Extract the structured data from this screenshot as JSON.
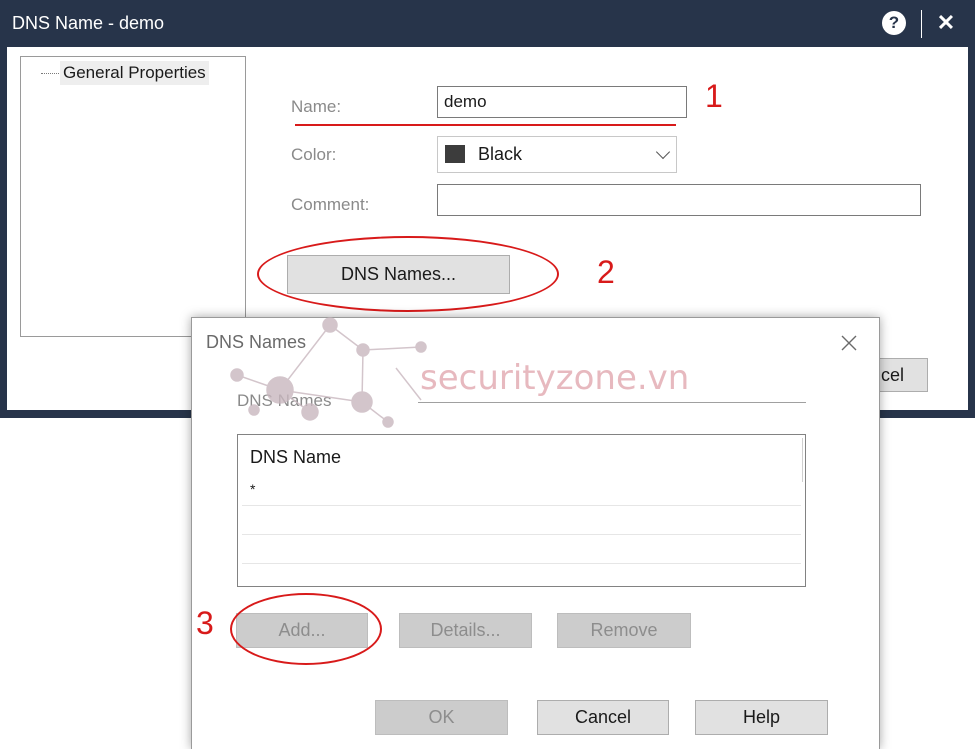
{
  "main_dialog": {
    "title": "DNS Name - demo",
    "help_icon_glyph": "?",
    "close_icon_glyph": "✕",
    "tree_item": "General Properties",
    "name_label": "Name:",
    "name_value": "demo",
    "color_label": "Color:",
    "color_value": "Black",
    "color_swatch": "#3c3c3c",
    "comment_label": "Comment:",
    "comment_value": "",
    "dns_names_button": "DNS Names...",
    "cancel_button_visible": "cel"
  },
  "sub_dialog": {
    "title": "DNS Names",
    "close_icon_glyph": "✕",
    "group_label": "DNS Names",
    "table_header": "DNS Name",
    "rows": [
      "*"
    ],
    "add_button": "Add...",
    "details_button": "Details...",
    "remove_button": "Remove",
    "ok_button": "OK",
    "cancel_button": "Cancel",
    "help_button": "Help"
  },
  "annotations": {
    "one": "1",
    "two": "2",
    "three": "3",
    "color": "#d81a1a"
  },
  "watermark": {
    "text": "securityzone.vn"
  },
  "colors": {
    "titlebar": "#27344a",
    "annotation": "#d81a1a"
  }
}
